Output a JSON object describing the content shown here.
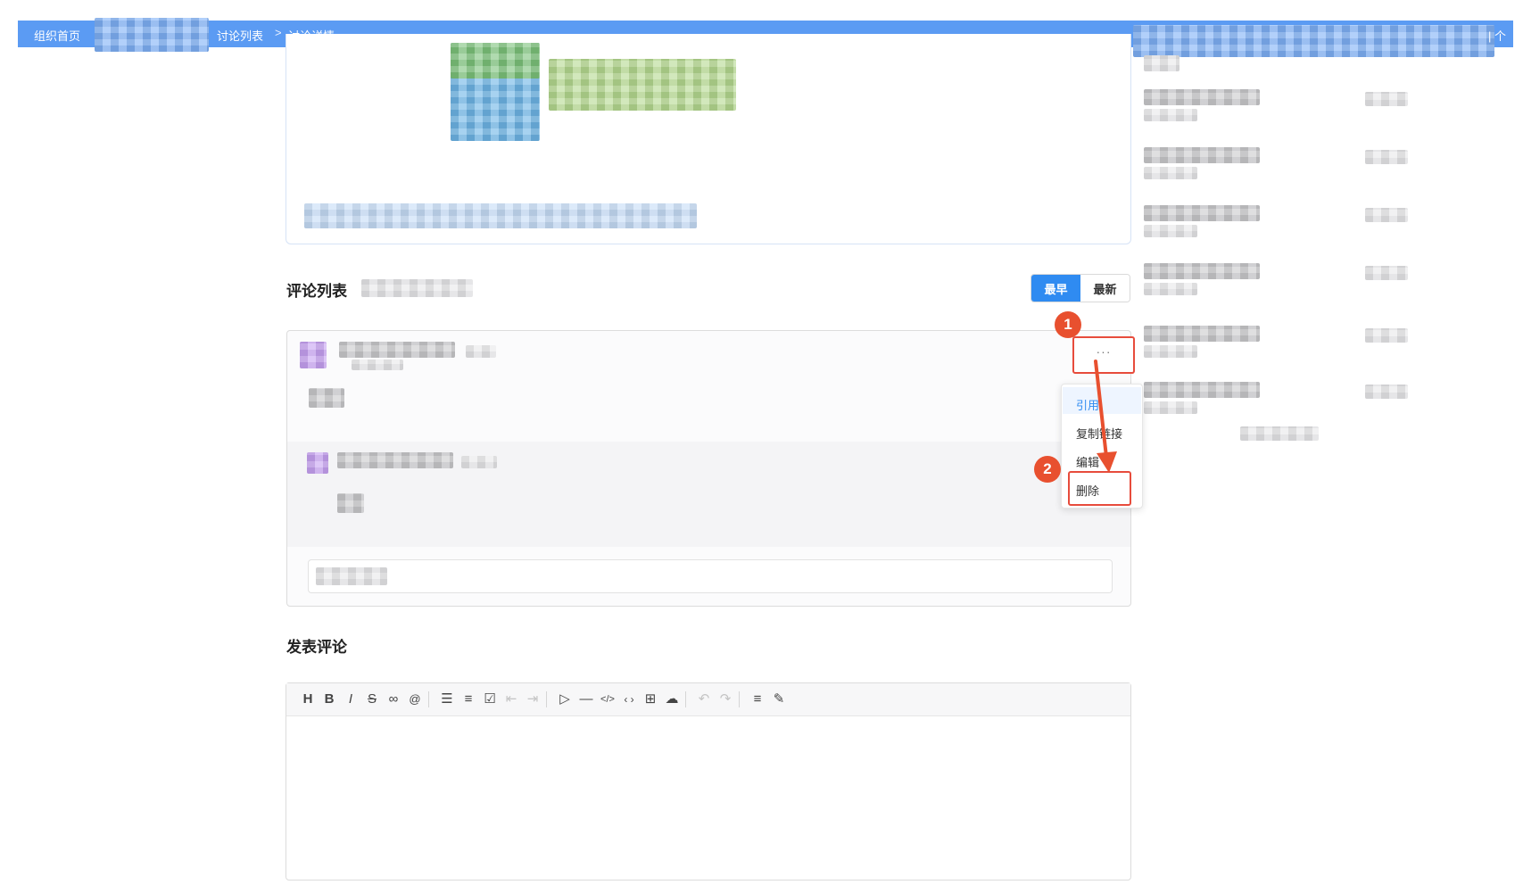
{
  "breadcrumb": {
    "home": "组织首页",
    "list": "讨论列表",
    "detail": "讨论详情",
    "separator": ">",
    "right_marker": "| 个"
  },
  "comments": {
    "title": "评论列表",
    "sort": {
      "earliest": "最早",
      "latest": "最新",
      "active": "最早"
    },
    "more_label": "···"
  },
  "context_menu": {
    "items": [
      "引用",
      "复制链接",
      "编辑",
      "删除"
    ]
  },
  "annotations": {
    "step1": "1",
    "step2": "2"
  },
  "post_comment": {
    "title": "发表评论",
    "toolbar_icons": [
      "heading-icon",
      "bold-icon",
      "italic-icon",
      "strikethrough-icon",
      "link-icon",
      "mention-icon",
      "bullet-list-icon",
      "ordered-list-icon",
      "checklist-icon",
      "outdent-icon",
      "indent-icon",
      "quote-icon",
      "horizontal-rule-icon",
      "inline-code-icon",
      "code-block-icon",
      "table-icon",
      "upload-icon",
      "undo-icon",
      "redo-icon",
      "align-icon",
      "edit-icon"
    ]
  },
  "colors": {
    "topbar": "#5b9bf3",
    "accent": "#2f8bf1",
    "annotation": "#e8502f"
  }
}
